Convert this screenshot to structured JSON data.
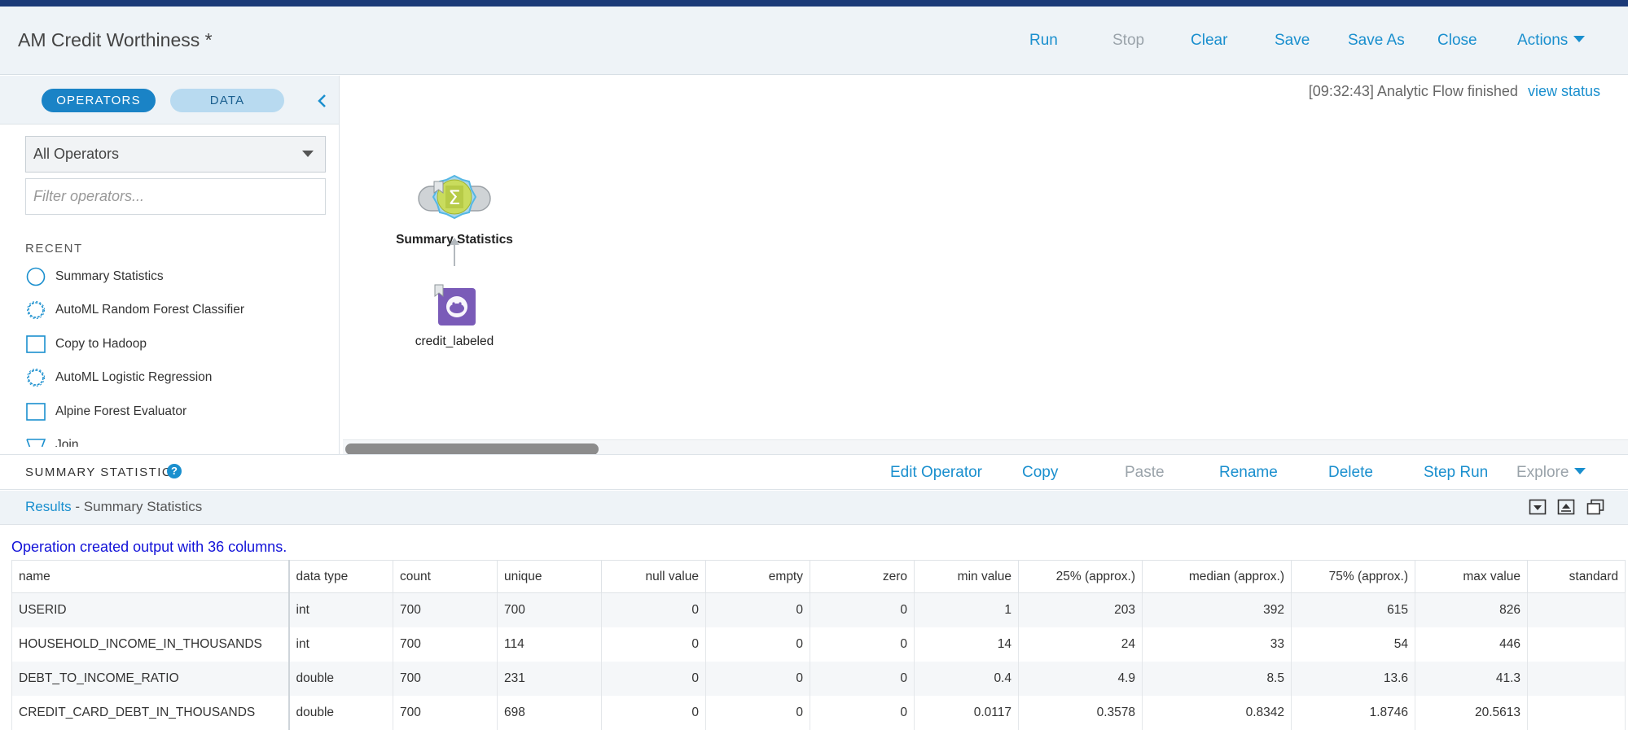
{
  "header": {
    "title": "AM Credit Worthiness *",
    "run": "Run",
    "stop": "Stop",
    "clear": "Clear",
    "save": "Save",
    "save_as": "Save As",
    "close": "Close",
    "actions": "Actions"
  },
  "sidebar": {
    "tab_operators": "OPERATORS",
    "tab_data": "DATA",
    "select_value": "All Operators",
    "filter_placeholder": "Filter operators...",
    "recent_heading": "RECENT",
    "recent": [
      {
        "label": "Summary Statistics",
        "icon": "circle-icon"
      },
      {
        "label": "AutoML Random Forest Classifier",
        "icon": "gear-icon"
      },
      {
        "label": "Copy to Hadoop",
        "icon": "square-icon"
      },
      {
        "label": "AutoML Logistic Regression",
        "icon": "gear-icon"
      },
      {
        "label": "Alpine Forest Evaluator",
        "icon": "square-icon"
      },
      {
        "label": "Join",
        "icon": "funnel-icon"
      }
    ]
  },
  "canvas": {
    "status_text": "[09:32:43] Analytic Flow finished",
    "view_status": "view status",
    "nodes": {
      "summary": "Summary Statistics",
      "credit": "credit_labeled"
    }
  },
  "operator_bar": {
    "title": "SUMMARY STATISTICS",
    "help": "?",
    "edit": "Edit Operator",
    "copy": "Copy",
    "paste": "Paste",
    "rename": "Rename",
    "delete": "Delete",
    "step_run": "Step Run",
    "explore": "Explore"
  },
  "results": {
    "link": "Results",
    "sep": " - ",
    "title": "Summary Statistics",
    "message": "Operation created output with 36 columns."
  },
  "table": {
    "headers": [
      "name",
      "data type",
      "count",
      "unique",
      "null value",
      "empty",
      "zero",
      "min value",
      "25% (approx.)",
      "median (approx.)",
      "75% (approx.)",
      "max value",
      "standard"
    ],
    "rows": [
      [
        "USERID",
        "int",
        "700",
        "700",
        "0",
        "0",
        "0",
        "1",
        "203",
        "392",
        "615",
        "826",
        ""
      ],
      [
        "HOUSEHOLD_INCOME_IN_THOUSANDS",
        "int",
        "700",
        "114",
        "0",
        "0",
        "0",
        "14",
        "24",
        "33",
        "54",
        "446",
        ""
      ],
      [
        "DEBT_TO_INCOME_RATIO",
        "double",
        "700",
        "231",
        "0",
        "0",
        "0",
        "0.4",
        "4.9",
        "8.5",
        "13.6",
        "41.3",
        ""
      ],
      [
        "CREDIT_CARD_DEBT_IN_THOUSANDS",
        "double",
        "700",
        "698",
        "0",
        "0",
        "0",
        "0.0117",
        "0.3578",
        "0.8342",
        "1.8746",
        "20.5613",
        ""
      ]
    ]
  },
  "colors": {
    "accent": "#1a8fce",
    "top_strip": "#1b3a78",
    "message": "#1212d8"
  }
}
